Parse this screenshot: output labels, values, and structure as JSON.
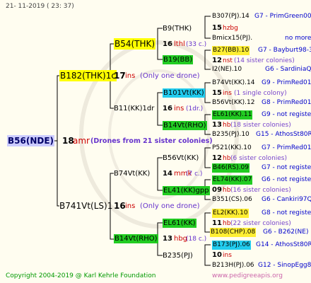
{
  "header": {
    "date": "21- 11-2019 ( 23: 37)"
  },
  "footer": {
    "copyright": "Copyright 2004-2019 @ Karl Kehrle Foundation",
    "url": "www.pedigreeapis.org"
  },
  "root": {
    "id": "B56(NDE)",
    "drone_num": "18",
    "drone_code": "amr",
    "drone_note": "(Drones from 21 sister colonies)"
  },
  "sire": {
    "id": "B182(THK)1c",
    "num": "17",
    "code": "ins",
    "note": "(Only one drone)"
  },
  "dam": {
    "id": "B741Vt(LS)1",
    "num": "16",
    "code": "ins",
    "note": "(Only one drone)"
  },
  "ss": {
    "id": "B54(THK)",
    "num": "16",
    "code": "lthl",
    "note": "(33 c.)"
  },
  "sd": {
    "id": "B11(KK)1dr",
    "num": "16",
    "code": "ins",
    "note": "(1dr.)"
  },
  "ds": {
    "id": "B74Vt(KK)",
    "num": "14",
    "code": "mmk",
    "note": "(7 c.)"
  },
  "dd": {
    "id": "B14Vt(RHO)",
    "num": "13",
    "code": "hbg",
    "note": "(18 c.)"
  },
  "level3": [
    {
      "id": "B9(THK)"
    },
    {
      "id": "B19(BB)"
    },
    {
      "id": "B101Vt(KK)"
    },
    {
      "id": "B14Vt(RHO)"
    },
    {
      "id": "B56Vt(KK)"
    },
    {
      "id": "EL41(KK)gpp"
    },
    {
      "id": "EL61(KK)"
    },
    {
      "id": "B235(PJ)"
    }
  ],
  "level4": [
    {
      "line1": "B307(PJ).14",
      "line1b": "G7 - PrimGreen00",
      "num": "15",
      "code": "hzbg",
      "line3": "Bmicx15(PJ).",
      "line3b": "no more"
    },
    {
      "line1": "B27(BB).10",
      "line1b": "G7 - Bayburt98-3",
      "num": "12",
      "code": "nst",
      "note": "(14 sister colonies)",
      "line3": "I2(NE).10",
      "line3b": "G6 - SardiniaQ"
    },
    {
      "line1": "B74Vt(KK).14",
      "line1b": "G9 - PrimRed01",
      "num": "15",
      "code": "ins",
      "note": "(1 single colony)",
      "line3": "B56Vt(KK).12",
      "line3b": "G8 - PrimRed01"
    },
    {
      "line1": "EL61(KK).11",
      "line1b": "G9 - not registe",
      "num": "13",
      "code": "hb",
      "note": "(18 sister colonies)",
      "line3": "B235(PJ).10",
      "line3b": "G15 - AthosSt80R"
    },
    {
      "line1": "P521(KK).10",
      "line1b": "G7 - PrimRed01",
      "num": "12",
      "code": "hb",
      "note": "(6 sister colonies)",
      "line3": "B46(RS).09",
      "line3b": "G7 - not registe"
    },
    {
      "line1": "EL74(KK).07",
      "line1b": "G6 - not registe",
      "num": "09",
      "code": "hb",
      "note": "(16 sister colonies)",
      "line3": "B351(CS).06",
      "line3b": "G6 - Cankiri97Q"
    },
    {
      "line1": "EL2(KK).10",
      "line1b": "G8 - not registe",
      "num": "11",
      "code": "hb",
      "note": "(22 sister colonies)",
      "line3": "B108(CHP).08",
      "line3b": "G6 - B262(NE)"
    },
    {
      "line1": "B173(PJ).06",
      "line1b": "G14 - AthosSt80R",
      "num": "10",
      "code": "ins",
      "note": "",
      "line3": "B213H(PJ).06",
      "line3b": "G12 - SinopEgg86R"
    }
  ]
}
